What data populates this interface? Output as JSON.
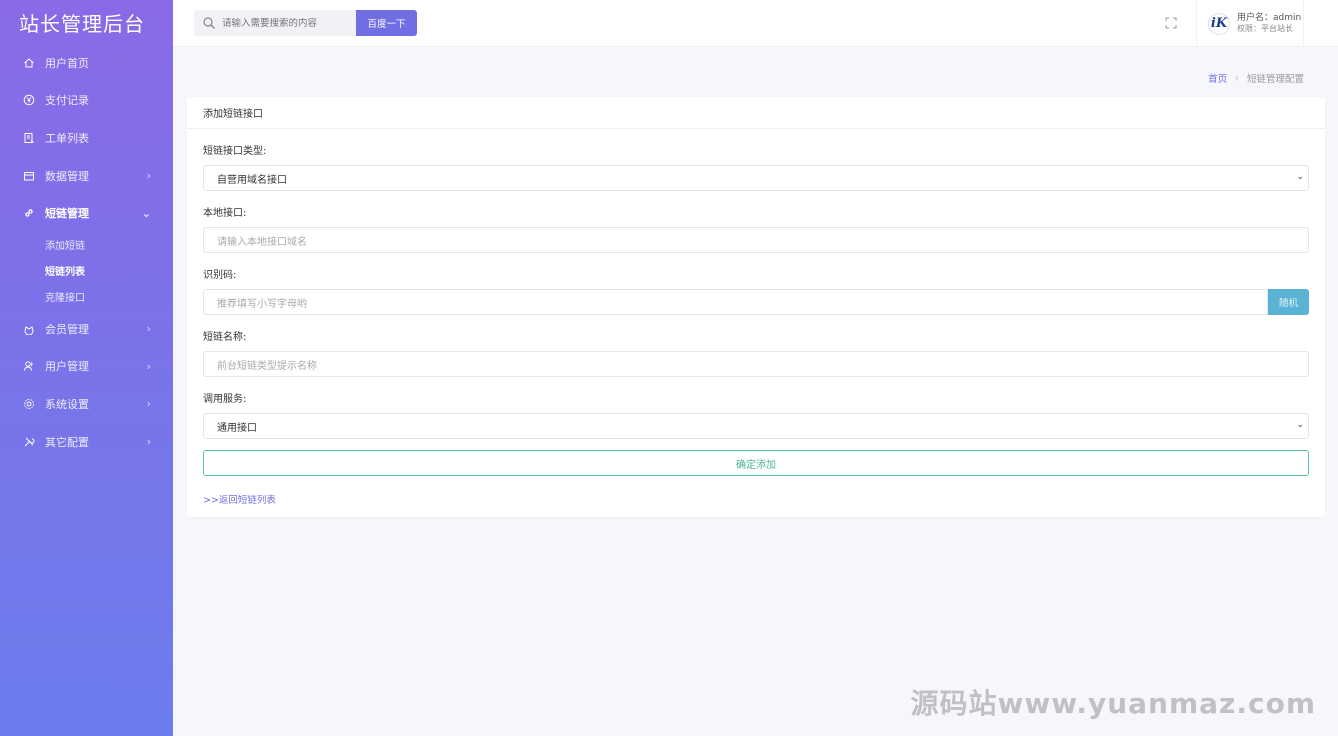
{
  "app": {
    "title": "站长管理后台"
  },
  "sidebar": {
    "items": [
      {
        "label": "用户首页",
        "icon": "home-icon"
      },
      {
        "label": "支付记录",
        "icon": "yen-icon"
      },
      {
        "label": "工单列表",
        "icon": "ticket-icon"
      },
      {
        "label": "数据管理",
        "icon": "database-icon",
        "chevron": "›"
      },
      {
        "label": "短链管理",
        "icon": "link-icon",
        "chevron": "⌄",
        "children": [
          {
            "label": "添加短链"
          },
          {
            "label": "短链列表"
          },
          {
            "label": "克隆接口"
          }
        ]
      },
      {
        "label": "会员管理",
        "icon": "member-icon",
        "chevron": "›"
      },
      {
        "label": "用户管理",
        "icon": "users-icon",
        "chevron": "›"
      },
      {
        "label": "系统设置",
        "icon": "gear-icon",
        "chevron": "›"
      },
      {
        "label": "其它配置",
        "icon": "tools-icon",
        "chevron": "›"
      }
    ]
  },
  "header": {
    "search_placeholder": "请输入需要搜索的内容",
    "search_button": "百度一下",
    "user_name": "用户名：admin",
    "user_role": "权限：平台站长",
    "avatar_letter": "iK"
  },
  "breadcrumb": {
    "home": "首页",
    "sep": "›",
    "current": "短链管理配置"
  },
  "card": {
    "title": "添加短链接口",
    "fields": {
      "type_label": "短链接口类型:",
      "type_value": "自营用域名接口",
      "local_label": "本地接口:",
      "local_placeholder": "请输入本地接口域名",
      "code_label": "识别码:",
      "code_placeholder": "推荐填写小写字母哟",
      "random_button": "随机",
      "name_label": "短链名称:",
      "name_placeholder": "前台短链类型提示名称",
      "service_label": "调用服务:",
      "service_value": "通用接口"
    },
    "submit": "确定添加",
    "back_link": ">>返回短链列表"
  },
  "watermark": "源码站www.yuanmaz.com",
  "colors": {
    "accent": "#6f6fe3",
    "sidebar_top": "#8a6ae6",
    "sidebar_bottom": "#6c7cec",
    "success": "#59c59a",
    "info": "#5ab2d4"
  }
}
